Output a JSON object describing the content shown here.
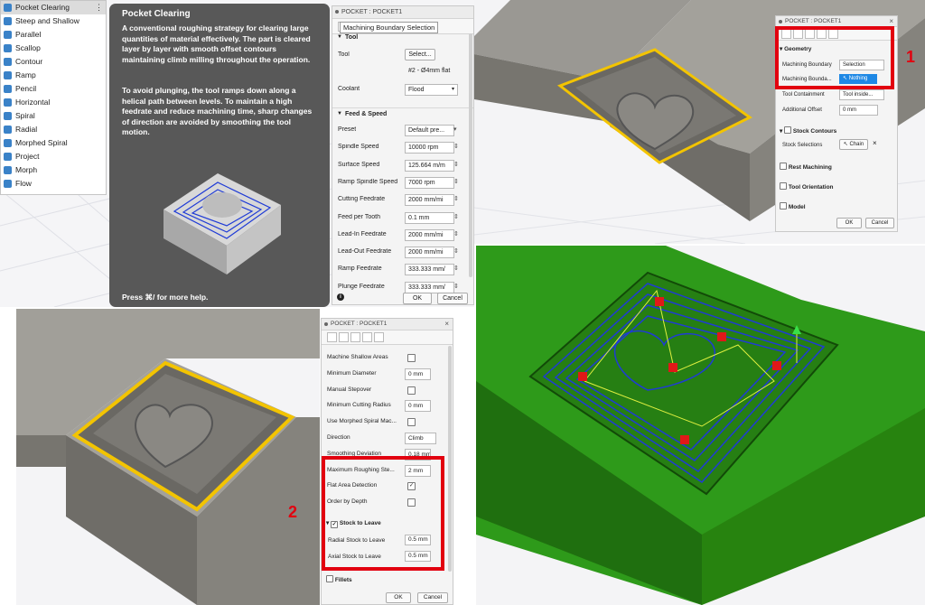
{
  "menu": {
    "items": [
      "Pocket Clearing",
      "Steep and Shallow",
      "Parallel",
      "Scallop",
      "Contour",
      "Ramp",
      "Pencil",
      "Horizontal",
      "Spiral",
      "Radial",
      "Morphed Spiral",
      "Project",
      "Morph",
      "Flow"
    ],
    "more_glyph": "⋮",
    "selected_index": 0
  },
  "tooltip": {
    "title": "Pocket Clearing",
    "paragraph1": "A conventional roughing strategy for clearing large quantities of material effectively. The part is cleared layer by layer with smooth offset contours maintaining climb milling throughout the operation.",
    "paragraph2": "To avoid plunging, the tool ramps down along a helical path between levels. To maintain a high feedrate and reduce machining time, sharp changes of direction are avoided by smoothing the tool motion.",
    "footer": "Press ⌘/ for more help."
  },
  "panel1": {
    "title": "POCKET : POCKET1",
    "tab_tooltip": "Machining Boundary Selection",
    "tool_section": "Tool",
    "tool_label": "Tool",
    "tool_button": "Select...",
    "tool_desc": "#2 - Ø4mm flat",
    "coolant_label": "Coolant",
    "coolant_value": "Flood",
    "feed_section": "Feed & Speed",
    "rows": [
      {
        "label": "Preset",
        "value": "Default pre..."
      },
      {
        "label": "Spindle Speed",
        "value": "10000 rpm"
      },
      {
        "label": "Surface Speed",
        "value": "125.664 m/m"
      },
      {
        "label": "Ramp Spindle Speed",
        "value": "7000 rpm"
      },
      {
        "label": "Cutting Feedrate",
        "value": "2000 mm/mi"
      },
      {
        "label": "Feed per Tooth",
        "value": "0.1 mm"
      },
      {
        "label": "Lead-In Feedrate",
        "value": "2000 mm/mi"
      },
      {
        "label": "Lead-Out Feedrate",
        "value": "2000 mm/mi"
      },
      {
        "label": "Ramp Feedrate",
        "value": "333.333 mm/"
      },
      {
        "label": "Plunge Feedrate",
        "value": "333.333 mm/"
      }
    ],
    "ok": "OK",
    "cancel": "Cancel",
    "info": "i"
  },
  "panel2": {
    "title": "POCKET : POCKET1",
    "geometry_section": "Geometry",
    "rows": [
      {
        "label": "Machining Boundary",
        "value": "Selection"
      },
      {
        "label": "Machining Bounda...",
        "value": "Nothing"
      },
      {
        "label": "Tool Containment",
        "value": "Tool inside..."
      },
      {
        "label": "Additional Offset",
        "value": "0 mm"
      }
    ],
    "stock_contours": "Stock Contours",
    "stock_selections_label": "Stock Selections",
    "chain_label": "Chain",
    "rest_machining": "Rest Machining",
    "tool_orientation": "Tool Orientation",
    "model": "Model",
    "ok": "OK",
    "cancel": "Cancel",
    "callout": "1"
  },
  "panel3": {
    "title": "POCKET : POCKET1",
    "rows": [
      {
        "label": "Machine Shallow Areas",
        "type": "check",
        "checked": false
      },
      {
        "label": "Minimum Diameter",
        "type": "input",
        "value": "0 mm"
      },
      {
        "label": "Manual Stepover",
        "type": "check",
        "checked": false
      },
      {
        "label": "Minimum Cutting Radius",
        "type": "input",
        "value": "0 mm"
      },
      {
        "label": "Use Morphed Spiral Mac...",
        "type": "check",
        "checked": false
      },
      {
        "label": "Direction",
        "type": "select",
        "value": "Climb"
      },
      {
        "label": "Smoothing Deviation",
        "type": "input",
        "value": "0.18 mm"
      },
      {
        "label": "Maximum Roughing Ste...",
        "type": "input",
        "value": "2 mm"
      },
      {
        "label": "Flat Area Detection",
        "type": "check",
        "checked": true
      },
      {
        "label": "Order by Depth",
        "type": "check",
        "checked": false
      }
    ],
    "stock_to_leave": "Stock to Leave",
    "radial_label": "Radial Stock to Leave",
    "radial_value": "0.5 mm",
    "axial_label": "Axial Stock to Leave",
    "axial_value": "0.5 mm",
    "fillets": "Fillets",
    "ok": "OK",
    "cancel": "Cancel",
    "callout": "2"
  },
  "colors": {
    "model_grey": "#8d8b86",
    "boundary_yellow": "#f3c400",
    "toolpath_blue": "#1f3bd6",
    "green_model": "#2e9a1a",
    "callout_red": "#e2000f",
    "tooltip_bg": "#585858",
    "selection_blue": "#1e88e5"
  }
}
